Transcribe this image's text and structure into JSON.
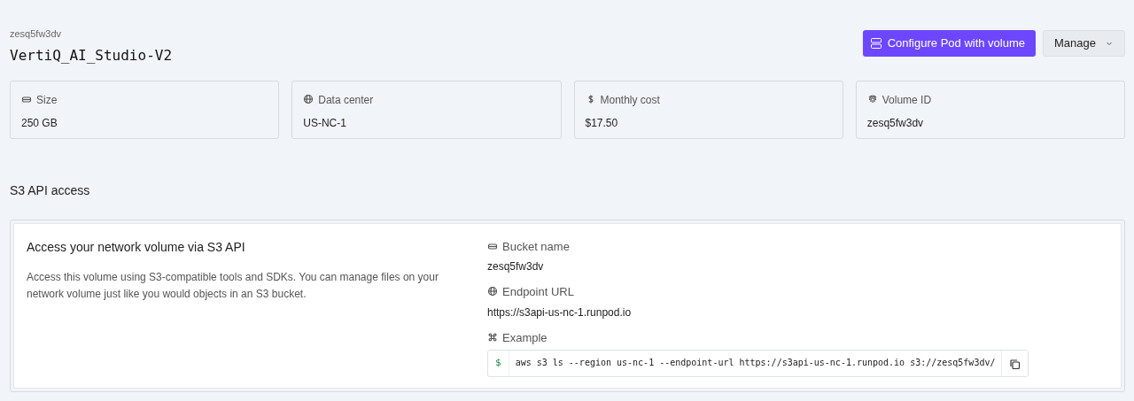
{
  "header": {
    "subtitle": "zesq5fw3dv",
    "title": "VertiQ_AI_Studio-V2",
    "primary_button": "Configure Pod with volume",
    "manage_button": "Manage"
  },
  "stats": [
    {
      "label": "Size",
      "value": "250 GB"
    },
    {
      "label": "Data center",
      "value": "US-NC-1"
    },
    {
      "label": "Monthly cost",
      "value": "$17.50"
    },
    {
      "label": "Volume ID",
      "value": "zesq5fw3dv"
    }
  ],
  "s3": {
    "heading": "S3 API access",
    "title": "Access your network volume via S3 API",
    "description": "Access this volume using S3-compatible tools and SDKs. You can manage files on your network volume just like you would objects in an S3 bucket.",
    "fields": [
      {
        "label": "Bucket name",
        "value": "zesq5fw3dv"
      },
      {
        "label": "Endpoint URL",
        "value": "https://s3api-us-nc-1.runpod.io"
      }
    ],
    "example": {
      "label": "Example",
      "prompt": "$",
      "command": "aws s3 ls --region us-nc-1 --endpoint-url https://s3api-us-nc-1.runpod.io s3://zesq5fw3dv/"
    }
  }
}
